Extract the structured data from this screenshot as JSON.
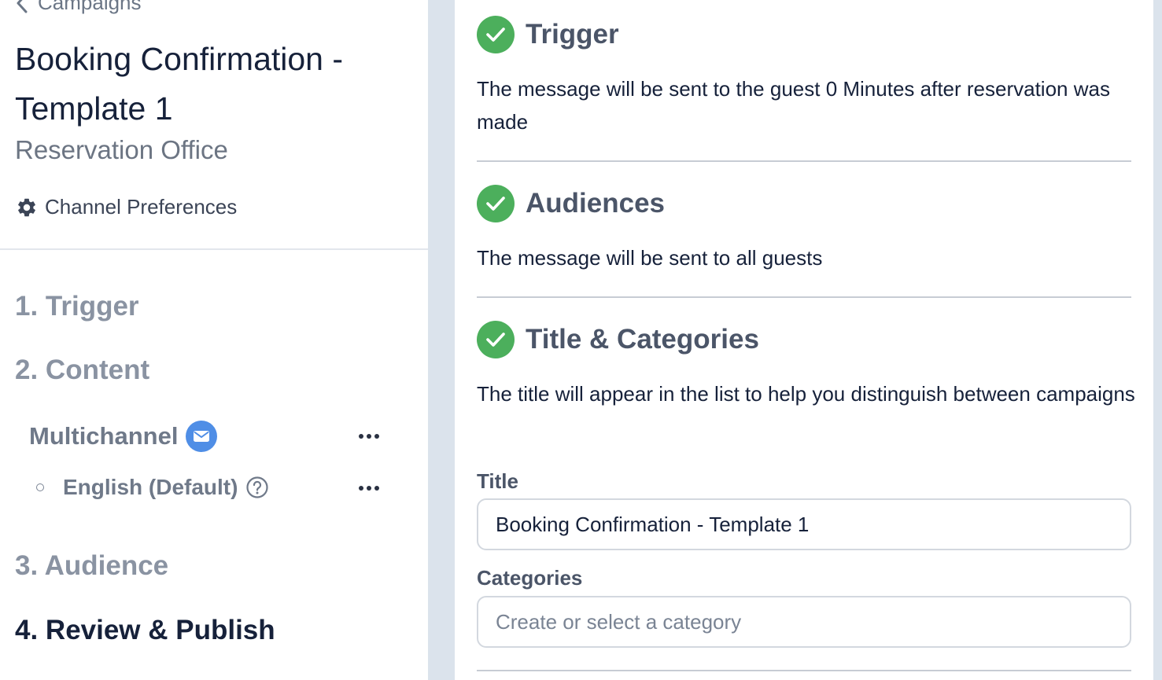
{
  "sidebar": {
    "back_label": "Campaigns",
    "title": "Booking Confirmation - Template 1",
    "subtitle": "Reservation Office",
    "channel_prefs_label": "Channel Preferences",
    "steps": [
      {
        "label": "1. Trigger"
      },
      {
        "label": "2. Content"
      },
      {
        "label": "3. Audience"
      },
      {
        "label": "4. Review & Publish"
      }
    ],
    "content_channel": {
      "label": "Multichannel"
    },
    "content_language": {
      "label": "English (Default)"
    }
  },
  "main": {
    "sections": [
      {
        "title": "Trigger",
        "text": "The message will be sent to the guest 0 Minutes after reservation was made"
      },
      {
        "title": "Audiences",
        "text": "The message will be sent to all guests"
      },
      {
        "title": "Title & Categories",
        "text": "The title will appear in the list to help you distinguish between campaigns"
      }
    ],
    "title_field": {
      "label": "Title",
      "value": "Booking Confirmation - Template 1"
    },
    "categories_field": {
      "label": "Categories",
      "placeholder": "Create or select a category"
    }
  },
  "colors": {
    "success": "#4caf5c",
    "accent_blue": "#4f8ee6",
    "background": "#dbe3ec"
  },
  "icons": [
    "chevron-left-icon",
    "gear-icon",
    "mail-icon",
    "more-icon",
    "help-icon",
    "check-circle-icon"
  ]
}
